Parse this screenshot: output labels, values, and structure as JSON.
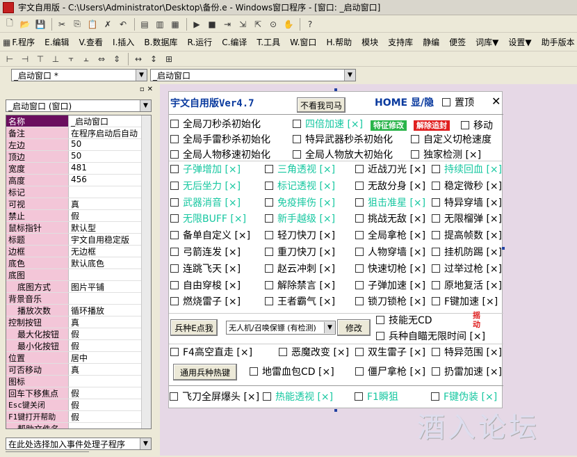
{
  "window": {
    "title": "宇文自用版 - C:\\Users\\Administrator\\Desktop\\备份.e - Windows窗口程序 - [窗口: _启动窗口]"
  },
  "menu": [
    "F.程序",
    "E.编辑",
    "V.查看",
    "I.插入",
    "B.数据库",
    "R.运行",
    "C.编译",
    "T.工具",
    "W.窗口",
    "H.帮助",
    "模块",
    "支持库",
    "静编",
    "便签",
    "词库▼",
    "设置▼",
    "助手版本"
  ],
  "combos": {
    "left": "_启动窗口 *",
    "right": "_启动窗口"
  },
  "panel": {
    "object_combo": "_启动窗口 (窗口)",
    "event_combo": "在此处选择加入事件处理子程序",
    "props": [
      {
        "n": "名称",
        "v": "_启动窗口",
        "sel": true
      },
      {
        "n": "备注",
        "v": "在程序启动后自动"
      },
      {
        "n": "左边",
        "v": "50"
      },
      {
        "n": "顶边",
        "v": "50"
      },
      {
        "n": "宽度",
        "v": "481"
      },
      {
        "n": "高度",
        "v": "456"
      },
      {
        "n": "标记",
        "v": ""
      },
      {
        "n": "可视",
        "v": "真"
      },
      {
        "n": "禁止",
        "v": "假"
      },
      {
        "n": "鼠标指针",
        "v": "默认型"
      },
      {
        "n": "标题",
        "v": "宇文自用稳定版"
      },
      {
        "n": "边框",
        "v": "无边框"
      },
      {
        "n": "底色",
        "v": "默认底色"
      },
      {
        "n": "底图",
        "v": ""
      },
      {
        "n": "底图方式",
        "v": "图片平铺",
        "indent": true
      },
      {
        "n": "背景音乐",
        "v": ""
      },
      {
        "n": "播放次数",
        "v": "循环播放",
        "indent": true
      },
      {
        "n": "控制按钮",
        "v": "真"
      },
      {
        "n": "最大化按钮",
        "v": "假",
        "indent": true
      },
      {
        "n": "最小化按钮",
        "v": "假",
        "indent": true
      },
      {
        "n": "位置",
        "v": "居中"
      },
      {
        "n": "可否移动",
        "v": "真"
      },
      {
        "n": "图标",
        "v": ""
      },
      {
        "n": "回车下移焦点",
        "v": "假"
      },
      {
        "n": "Esc键关闭",
        "v": "假"
      },
      {
        "n": "F1键打开帮助",
        "v": "假"
      },
      {
        "n": "帮助文件名",
        "v": "",
        "indent": true
      }
    ]
  },
  "form": {
    "title": "宇文自用版Ver4.7",
    "btn_hide": "不看我司马",
    "home": "HOME 显/隐",
    "top": "置顶",
    "close": "✕",
    "badge1": "特征修改",
    "badge2": "解除追封",
    "move": "移动",
    "rows": [
      [
        "全局刀秒杀初始化",
        "四倍加速 [×]",
        "",
        ""
      ],
      [
        "全局手雷秒杀初始化",
        "特异武器秒杀初始化",
        "自定义切枪速度",
        ""
      ],
      [
        "全局人物移速初始化",
        "全局人物放大初始化",
        "独家检测 [×]",
        ""
      ]
    ],
    "grid": [
      [
        "子弹增加 [×]",
        "三角透视 [×]",
        "近战刀光 [×]",
        "持续回血 [×]"
      ],
      [
        "无后坐力 [×]",
        "标记透视 [×]",
        "无敌分身 [×]",
        "稳定微秒 [×]"
      ],
      [
        "武器消音 [×]",
        "免疫摔伤 [×]",
        "狙击准星 [×]",
        "特异穿墙 [×]"
      ],
      [
        "无限BUFF [×]",
        "新手越级 [×]",
        "挑战无敌 [×]",
        "无限榴弹 [×]"
      ],
      [
        "备单自定义 [×]",
        "轻刀快刀 [×]",
        "全局拿枪 [×]",
        "提高帧数 [×]"
      ],
      [
        "弓箭连发 [×]",
        "重刀快刀 [×]",
        "人物穿墙 [×]",
        "挂机防踢 [×]"
      ],
      [
        "连跳飞天 [×]",
        "赵云冲刺 [×]",
        "快速切枪 [×]",
        "过举过枪 [×]"
      ],
      [
        "自由穿梭 [×]",
        "解除禁言 [×]",
        "子弹加速 [×]",
        "原地复活 [×]"
      ],
      [
        "燃烧雷子 [×]",
        "王者霸气 [×]",
        "锁刀锁枪 [×]",
        "F键加速 [×]"
      ]
    ],
    "btn_weapon": "兵种E点我",
    "select_weapon": "无人机/召唤保镖 (有检测)",
    "btn_modify": "修改",
    "skill_cd": "技能无CD",
    "auto_aim": "兵种自瞄无限时间 [×]",
    "shake": "摇动",
    "row_f4": [
      "F4高空直走 [×]",
      "恶魔改变 [×]",
      "双生雷子 [×]",
      "特异范围 [×]"
    ],
    "btn_hotkey": "通用兵种热键",
    "row_hot": [
      "地雷血包CD [×]",
      "僵尸拿枪 [×]",
      "扔雷加速 [×]"
    ],
    "row_last": [
      "飞刀全屏爆头 [×]",
      "热能透视 [×]",
      "F1瞬狙",
      "F键伪装 [×]"
    ]
  },
  "watermark": "酒入论坛"
}
